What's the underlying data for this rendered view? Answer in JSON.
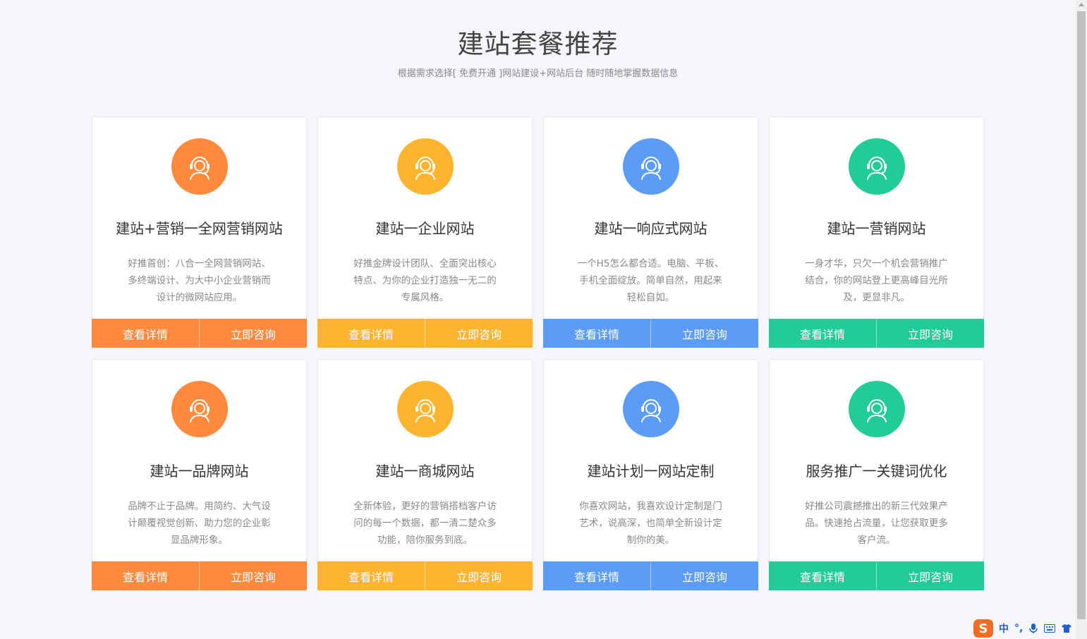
{
  "header": {
    "title": "建站套餐推荐",
    "subtitle": "根据需求选择[ 免费开通 ]网站建设+网站后台 随时随地掌握数据信息"
  },
  "cards": [
    {
      "title": "建站+营销一全网营销网站",
      "desc": "好推首创：八合一全网营销网站、多终端设计、为大中小企业营销而设计的微网站应用。",
      "btn_detail": "查看详情",
      "btn_consult": "立即咨询",
      "color": "#ff8a3d",
      "icon": "customer-service-icon"
    },
    {
      "title": "建站一企业网站",
      "desc": "好推金牌设计团队、全面突出核心特点、为你的企业打造独一无二的专属风格。",
      "btn_detail": "查看详情",
      "btn_consult": "立即咨询",
      "color": "#ffb42f",
      "icon": "customer-service-icon"
    },
    {
      "title": "建站一响应式网站",
      "desc": "一个H5怎么都合适。电脑、平板、手机全面绽放。简单自然，用起来轻松自如。",
      "btn_detail": "查看详情",
      "btn_consult": "立即咨询",
      "color": "#5b9cf7",
      "icon": "customer-service-icon"
    },
    {
      "title": "建站一营销网站",
      "desc": "一身才华，只欠一个机会营销推广结合，你的网站登上更高峰目光所及，更显非凡。",
      "btn_detail": "查看详情",
      "btn_consult": "立即咨询",
      "color": "#21cc97",
      "icon": "customer-service-icon"
    },
    {
      "title": "建站一品牌网站",
      "desc": "品牌不止于品牌。用简约、大气设计颠覆视觉创新、助力您的企业彰显品牌形象。",
      "btn_detail": "查看详情",
      "btn_consult": "立即咨询",
      "color": "#ff8a3d",
      "icon": "customer-service-icon"
    },
    {
      "title": "建站一商城网站",
      "desc": "全新体验，更好的营销搭档客户访问的每一个数据，都一清二楚众多功能，陪你服务到底。",
      "btn_detail": "查看详情",
      "btn_consult": "立即咨询",
      "color": "#ffb42f",
      "icon": "customer-service-icon"
    },
    {
      "title": "建站计划一网站定制",
      "desc": "你喜欢网站，我喜欢设计定制是门艺术，说高深，也简单全新设计定制你的美。",
      "btn_detail": "查看详情",
      "btn_consult": "立即咨询",
      "color": "#5b9cf7",
      "icon": "customer-service-icon"
    },
    {
      "title": "服务推广一关键词优化",
      "desc": "好推公司震撼推出的新三代效果产品。快速抢占流量，让您获取更多客户流。",
      "btn_detail": "查看详情",
      "btn_consult": "立即咨询",
      "color": "#21cc97",
      "icon": "customer-service-icon"
    }
  ],
  "ime": {
    "logo": "S",
    "lang": "中",
    "punct": "°,",
    "icons": [
      "microphone-icon",
      "keyboard-icon",
      "shirt-icon"
    ]
  }
}
